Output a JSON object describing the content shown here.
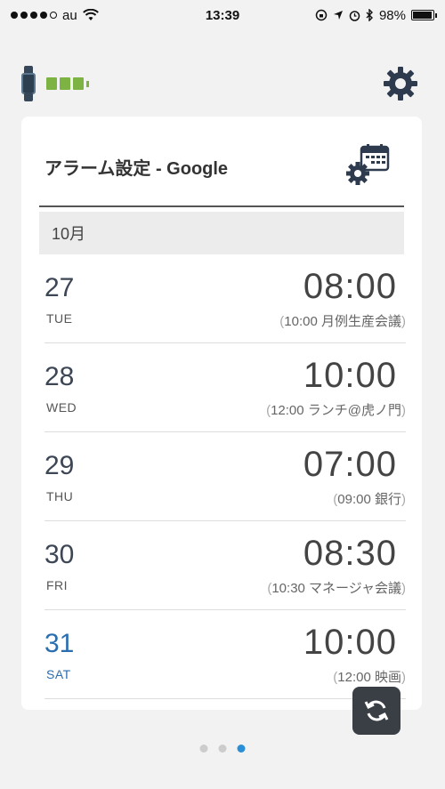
{
  "statusbar": {
    "carrier": "au",
    "time": "13:39",
    "battery": "98%"
  },
  "card": {
    "title": "アラーム設定 - Google",
    "month": "10月"
  },
  "alarms": [
    {
      "day": "27",
      "dow": "TUE",
      "time": "08:00",
      "event": "10:00 月例生産会議"
    },
    {
      "day": "28",
      "dow": "WED",
      "time": "10:00",
      "event": "12:00 ランチ@虎ノ門"
    },
    {
      "day": "29",
      "dow": "THU",
      "time": "07:00",
      "event": "09:00 銀行"
    },
    {
      "day": "30",
      "dow": "FRI",
      "time": "08:30",
      "event": "10:30 マネージャ会議"
    },
    {
      "day": "31",
      "dow": "SAT",
      "time": "10:00",
      "event": "12:00 映画"
    }
  ],
  "colors": {
    "accent": "#2b8fd6",
    "saturday": "#2a6eb0",
    "battery_green": "#7cb342"
  },
  "icons": {
    "settings": "gear-icon",
    "calendar_settings": "calendar-gear-icon",
    "sync": "sync-icon",
    "device": "wristband-icon"
  },
  "pager": {
    "total": 3,
    "active": 3
  }
}
